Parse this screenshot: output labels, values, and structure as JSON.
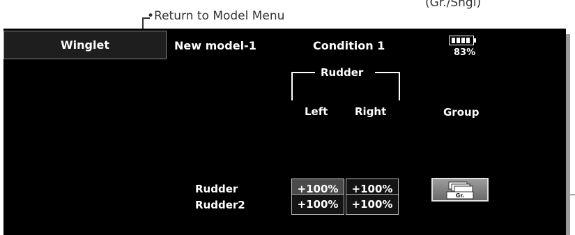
{
  "annotations": {
    "return_to_menu": "•Return to Model Menu",
    "group_mode": "(Gr./Sngl)"
  },
  "header": {
    "title": "Winglet",
    "model_name": "New model-1",
    "condition": "Condition 1",
    "battery_percent": "83%"
  },
  "table": {
    "group_label": "Rudder",
    "col_left": "Left",
    "col_right": "Right",
    "rows": [
      {
        "label": "Rudder",
        "left": "+100%",
        "right": "+100%"
      },
      {
        "label": "Rudder2",
        "left": "+100%",
        "right": "+100%"
      }
    ]
  },
  "group": {
    "label": "Group",
    "button_label": "Gr.",
    "icon": "group-icon"
  },
  "colors": {
    "screen_bg": "#000000",
    "selected_cell": "#4a4a4a",
    "annotation_text": "#333333"
  }
}
